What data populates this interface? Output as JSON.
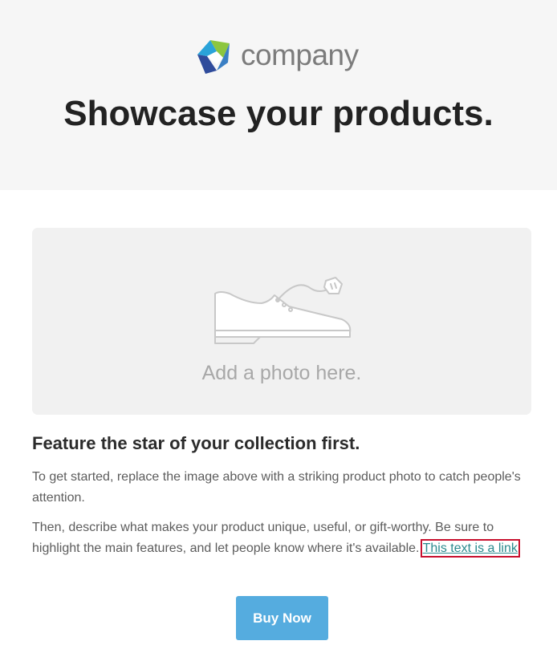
{
  "header": {
    "logo_text": "company",
    "headline": "Showcase your products."
  },
  "photo_placeholder": {
    "icon": "shoe-icon",
    "caption": "Add a photo here."
  },
  "feature": {
    "heading": "Feature the star of your collection first.",
    "paragraph1": "To get started, replace the image above with a striking product photo to catch people's attention.",
    "paragraph2_prefix": "Then, describe what makes your product unique, useful, or gift-worthy. Be sure to highlight the main features, and let people know where it's available. ",
    "link_text": "This text is a link",
    "paragraph2_suffix": "."
  },
  "cta": {
    "label": "Buy Now"
  },
  "colors": {
    "header_bg": "#f6f6f6",
    "button_bg": "#55acdf",
    "link": "#2a8a8e",
    "logo_green": "#8cc63f",
    "logo_blue": "#2aa3d9",
    "logo_navy": "#2f4b9b"
  }
}
